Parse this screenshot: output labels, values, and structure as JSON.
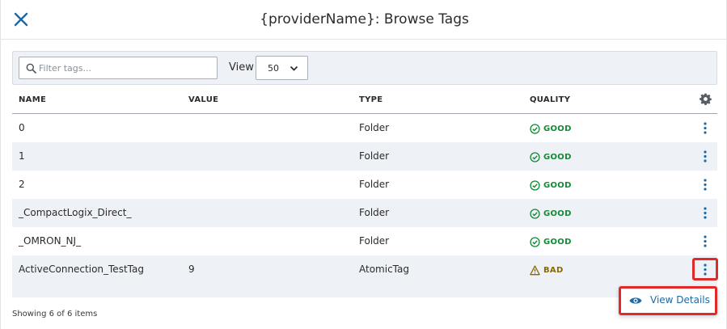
{
  "header": {
    "title": "{providerName}: Browse Tags",
    "close_icon": "close-icon"
  },
  "toolbar": {
    "filter_placeholder": "Filter tags...",
    "view_label": "View",
    "view_value": "50"
  },
  "table": {
    "columns": [
      "NAME",
      "VALUE",
      "TYPE",
      "QUALITY"
    ],
    "rows": [
      {
        "name": "0",
        "value": "",
        "type": "Folder",
        "quality": "GOOD"
      },
      {
        "name": "1",
        "value": "",
        "type": "Folder",
        "quality": "GOOD"
      },
      {
        "name": "2",
        "value": "",
        "type": "Folder",
        "quality": "GOOD"
      },
      {
        "name": "_CompactLogix_Direct_",
        "value": "",
        "type": "Folder",
        "quality": "GOOD"
      },
      {
        "name": "_OMRON_NJ_",
        "value": "",
        "type": "Folder",
        "quality": "GOOD"
      },
      {
        "name": "ActiveConnection_TestTag",
        "value": "9",
        "type": "AtomicTag",
        "quality": "BAD"
      }
    ]
  },
  "footer": {
    "status": "Showing 6 of 6 items"
  },
  "popover": {
    "label": "View Details"
  },
  "colors": {
    "accent": "#1b6aa8",
    "good": "#138a36",
    "bad": "#8a6a00",
    "highlight": "#e02a2a"
  }
}
